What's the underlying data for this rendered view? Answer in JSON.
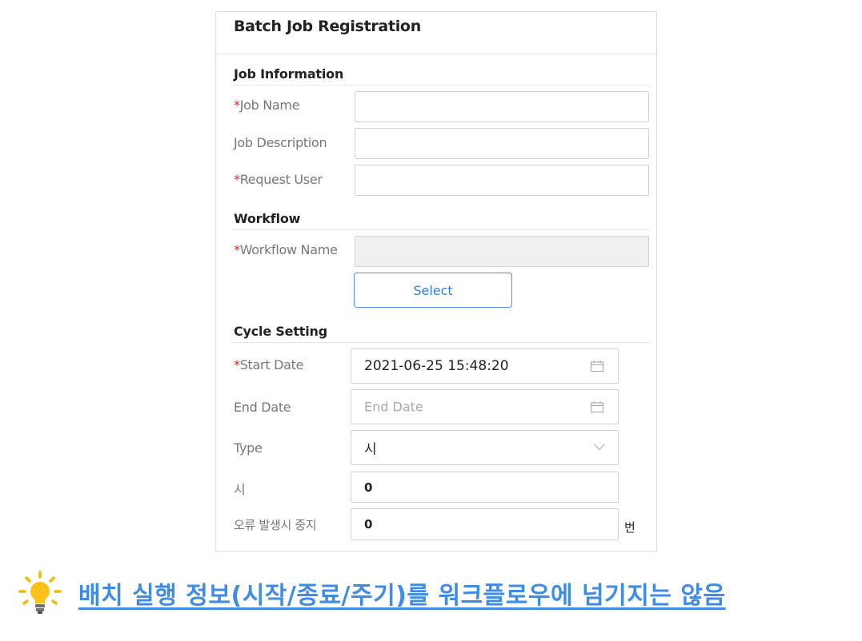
{
  "form": {
    "title": "Batch Job Registration",
    "sections": {
      "job_info": "Job Information",
      "workflow": "Workflow",
      "cycle": "Cycle Setting"
    },
    "required_mark": "*",
    "fields": {
      "job_name": {
        "label": "Job Name",
        "value": ""
      },
      "job_description": {
        "label": "Job Description",
        "value": ""
      },
      "request_user": {
        "label": "Request User",
        "value": ""
      },
      "workflow_name": {
        "label": "Workflow Name",
        "value": ""
      },
      "start_date": {
        "label": "Start Date",
        "value": "2021-06-25 15:48:20"
      },
      "end_date": {
        "label": "End Date",
        "placeholder": "End Date"
      },
      "type": {
        "label": "Type",
        "value": "시"
      },
      "hour": {
        "label": "시",
        "value": "0"
      },
      "stop_on_error": {
        "label": "오류 발생시 중지",
        "value": "0",
        "unit": "번"
      }
    },
    "select_button": "Select"
  },
  "banner": {
    "icon": "lightbulb-icon",
    "text": "배치 실행 정보(시작/종료/주기)를 워크플로우에 넘기지는 않음",
    "color": "#3e8ce6"
  },
  "colors": {
    "accent": "#4b8ef1",
    "required": "#e02424"
  }
}
